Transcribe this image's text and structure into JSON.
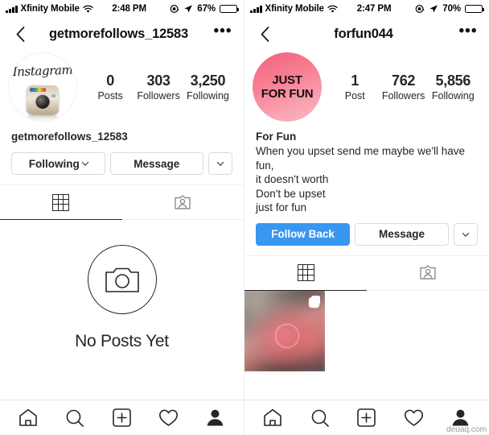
{
  "left": {
    "status": {
      "carrier": "Xfinity Mobile",
      "time": "2:48 PM",
      "battery_pct": "67%",
      "signal_icon": "signal-bars-icon",
      "wifi_icon": "wifi-icon",
      "rotation_lock_icon": "rotation-lock-icon",
      "location_icon": "location-arrow-icon",
      "battery_icon": "battery-icon"
    },
    "nav": {
      "back_icon": "chevron-left-icon",
      "title": "getmorefollows_12583",
      "more_label": "•••"
    },
    "profile": {
      "avatar_name": "instagram-retro-logo-avatar",
      "avatar_wordmark": "Instagram",
      "username": "getmorefollows_12583",
      "stats": [
        {
          "num": "0",
          "label": "Posts"
        },
        {
          "num": "303",
          "label": "Followers"
        },
        {
          "num": "3,250",
          "label": "Following"
        }
      ]
    },
    "actions": {
      "follow_label": "Following",
      "message_label": "Message",
      "caret_icon": "chevron-down-icon"
    },
    "tabs": {
      "grid_icon": "grid-icon",
      "tagged_icon": "tagged-person-icon"
    },
    "empty": {
      "camera_icon": "camera-icon",
      "label": "No Posts Yet"
    },
    "bottom_nav": [
      {
        "icon": "home-icon",
        "active": false
      },
      {
        "icon": "search-icon",
        "active": false
      },
      {
        "icon": "add-post-icon",
        "active": false
      },
      {
        "icon": "heart-icon",
        "active": false
      },
      {
        "icon": "profile-icon",
        "active": true
      }
    ]
  },
  "right": {
    "status": {
      "carrier": "Xfinity Mobile",
      "time": "2:47 PM",
      "battery_pct": "70%",
      "signal_icon": "signal-bars-icon",
      "wifi_icon": "wifi-icon",
      "rotation_lock_icon": "rotation-lock-icon",
      "location_icon": "location-arrow-icon",
      "battery_icon": "battery-icon"
    },
    "nav": {
      "back_icon": "chevron-left-icon",
      "title": "forfun044",
      "more_label": "•••"
    },
    "profile": {
      "avatar_name": "just-for-fun-avatar",
      "avatar_line1": "JUST",
      "avatar_line2": "FOR FUN",
      "avatar_color": "#f2607f",
      "display_name": "For Fun",
      "bio_lines": [
        "When you upset send me maybe we'll have",
        "fun,",
        "it doesn't worth",
        "Don't be upset",
        "just for fun"
      ],
      "stats": [
        {
          "num": "1",
          "label": "Post"
        },
        {
          "num": "762",
          "label": "Followers"
        },
        {
          "num": "5,856",
          "label": "Following"
        }
      ]
    },
    "actions": {
      "follow_label": "Follow Back",
      "follow_color": "#3897f0",
      "message_label": "Message",
      "caret_icon": "chevron-down-icon"
    },
    "tabs": {
      "grid_icon": "grid-icon",
      "tagged_icon": "tagged-person-icon"
    },
    "posts": [
      {
        "name": "post-thumbnail",
        "multi": true
      }
    ],
    "bottom_nav": [
      {
        "icon": "home-icon",
        "active": false
      },
      {
        "icon": "search-icon",
        "active": false
      },
      {
        "icon": "add-post-icon",
        "active": false
      },
      {
        "icon": "heart-icon",
        "active": false
      },
      {
        "icon": "profile-icon",
        "active": true
      }
    ]
  },
  "watermark": "deuaq.com"
}
